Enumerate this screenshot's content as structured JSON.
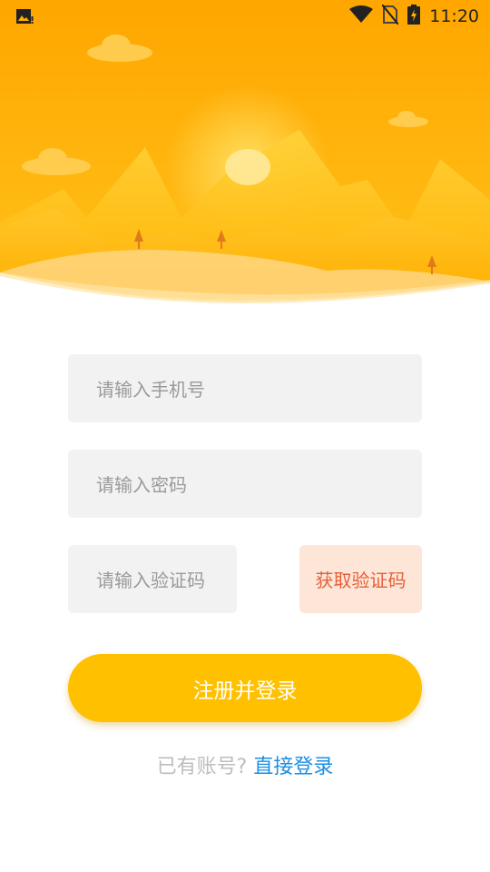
{
  "status_bar": {
    "time": "11:20",
    "icons": [
      "image-notification-icon",
      "wifi-icon",
      "no-sim-icon",
      "battery-charging-icon"
    ]
  },
  "colors": {
    "accent": "#ffc000",
    "hero_top": "#ffa800",
    "code_button_bg": "#fde6d8",
    "code_button_text": "#e5603a",
    "link": "#1a8fe3",
    "field_bg": "#f2f2f2"
  },
  "form": {
    "phone_placeholder": "请输入手机号",
    "password_placeholder": "请输入密码",
    "code_placeholder": "请输入验证码",
    "get_code_label": "获取验证码",
    "register_label": "注册并登录"
  },
  "footer": {
    "question": "已有账号?",
    "login_link": "直接登录"
  }
}
